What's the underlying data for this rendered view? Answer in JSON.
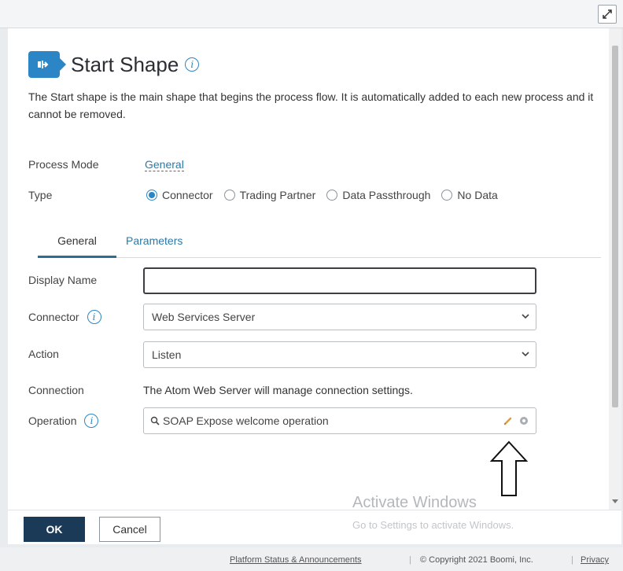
{
  "dialog": {
    "title": "Start Shape",
    "description": "The Start shape is the main shape that begins the process flow. It is automatically added to each new process and it cannot be removed.",
    "process_mode": {
      "label": "Process Mode",
      "value": "General"
    },
    "type": {
      "label": "Type",
      "options": [
        "Connector",
        "Trading Partner",
        "Data Passthrough",
        "No Data"
      ],
      "selected": "Connector"
    },
    "tabs": [
      {
        "label": "General",
        "active": true
      },
      {
        "label": "Parameters",
        "active": false
      }
    ],
    "fields": {
      "display_name": {
        "label": "Display Name",
        "value": ""
      },
      "connector": {
        "label": "Connector",
        "value": "Web Services Server"
      },
      "action": {
        "label": "Action",
        "value": "Listen"
      },
      "connection": {
        "label": "Connection",
        "value": "The Atom Web Server will manage connection settings."
      },
      "operation": {
        "label": "Operation",
        "value": "SOAP Expose welcome operation"
      }
    },
    "buttons": {
      "ok": "OK",
      "cancel": "Cancel"
    }
  },
  "info_glyph": "i",
  "watermark": {
    "title": "Activate Windows",
    "subtitle": "Go to Settings to activate Windows."
  },
  "bottom_bar": {
    "status": "Platform Status & Announcements",
    "copyright": "© Copyright 2021 Boomi, Inc.",
    "privacy": "Privacy",
    "separator": "|"
  },
  "icons": {
    "expand": "expand-icon",
    "start_shape": "start-shape-icon",
    "info": "info-icon",
    "dropdown": "chevron-down-icon",
    "search": "search-icon",
    "edit": "pencil-icon",
    "settings": "gear-icon",
    "annotation": "up-arrow-icon"
  },
  "colors": {
    "accent": "#2c86c5",
    "primary_button": "#1b3a57",
    "link": "#2a7aa8",
    "edit_icon": "#e0a030"
  }
}
